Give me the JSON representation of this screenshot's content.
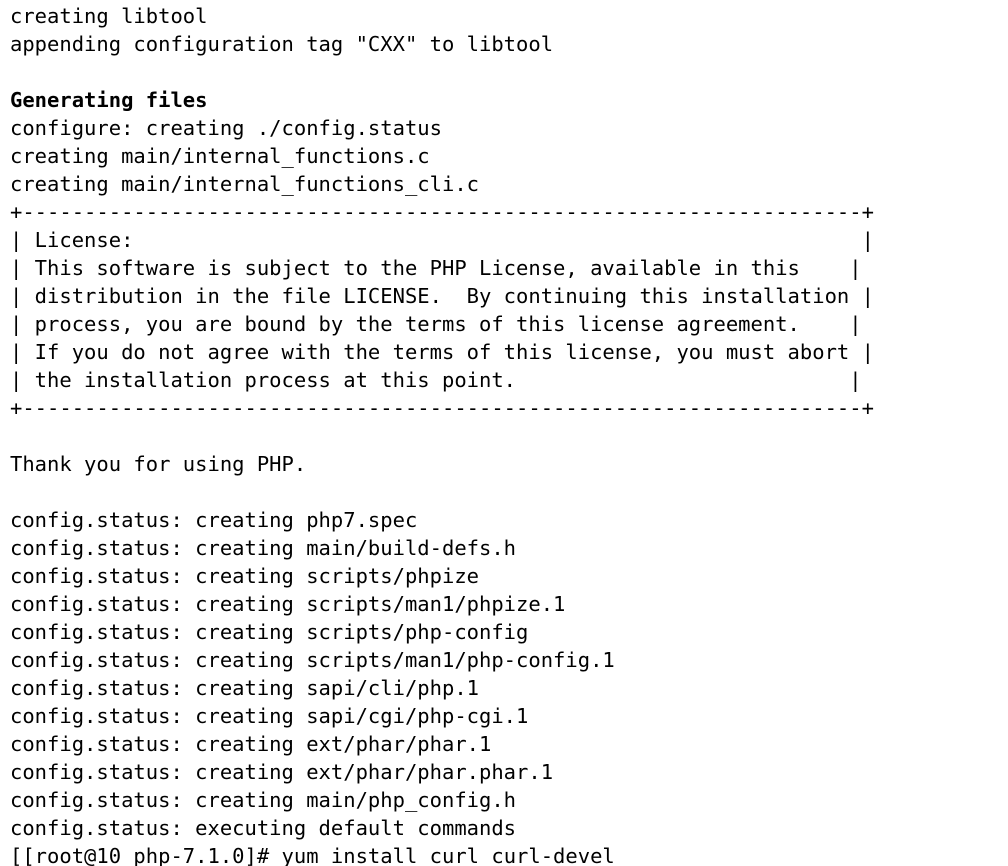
{
  "lines": [
    {
      "t": "creating libtool",
      "b": false
    },
    {
      "t": "appending configuration tag \"CXX\" to libtool",
      "b": false
    },
    {
      "t": "",
      "b": false
    },
    {
      "t": "Generating files",
      "b": true
    },
    {
      "t": "configure: creating ./config.status",
      "b": false
    },
    {
      "t": "creating main/internal_functions.c",
      "b": false
    },
    {
      "t": "creating main/internal_functions_cli.c",
      "b": false
    },
    {
      "t": "+--------------------------------------------------------------------+",
      "b": false
    },
    {
      "t": "| License:                                                           |",
      "b": false
    },
    {
      "t": "| This software is subject to the PHP License, available in this    |",
      "b": false
    },
    {
      "t": "| distribution in the file LICENSE.  By continuing this installation |",
      "b": false
    },
    {
      "t": "| process, you are bound by the terms of this license agreement.    |",
      "b": false
    },
    {
      "t": "| If you do not agree with the terms of this license, you must abort |",
      "b": false
    },
    {
      "t": "| the installation process at this point.                           |",
      "b": false
    },
    {
      "t": "+--------------------------------------------------------------------+",
      "b": false
    },
    {
      "t": "",
      "b": false
    },
    {
      "t": "Thank you for using PHP.",
      "b": false
    },
    {
      "t": "",
      "b": false
    },
    {
      "t": "config.status: creating php7.spec",
      "b": false
    },
    {
      "t": "config.status: creating main/build-defs.h",
      "b": false
    },
    {
      "t": "config.status: creating scripts/phpize",
      "b": false
    },
    {
      "t": "config.status: creating scripts/man1/phpize.1",
      "b": false
    },
    {
      "t": "config.status: creating scripts/php-config",
      "b": false
    },
    {
      "t": "config.status: creating scripts/man1/php-config.1",
      "b": false
    },
    {
      "t": "config.status: creating sapi/cli/php.1",
      "b": false
    },
    {
      "t": "config.status: creating sapi/cgi/php-cgi.1",
      "b": false
    },
    {
      "t": "config.status: creating ext/phar/phar.1",
      "b": false
    },
    {
      "t": "config.status: creating ext/phar/phar.phar.1",
      "b": false
    },
    {
      "t": "config.status: creating main/php_config.h",
      "b": false
    },
    {
      "t": "config.status: executing default commands",
      "b": false
    }
  ],
  "prompt_prefix": "[[root@10 php-7.1.0]# ",
  "prompt_command": "yum install curl curl-devel"
}
